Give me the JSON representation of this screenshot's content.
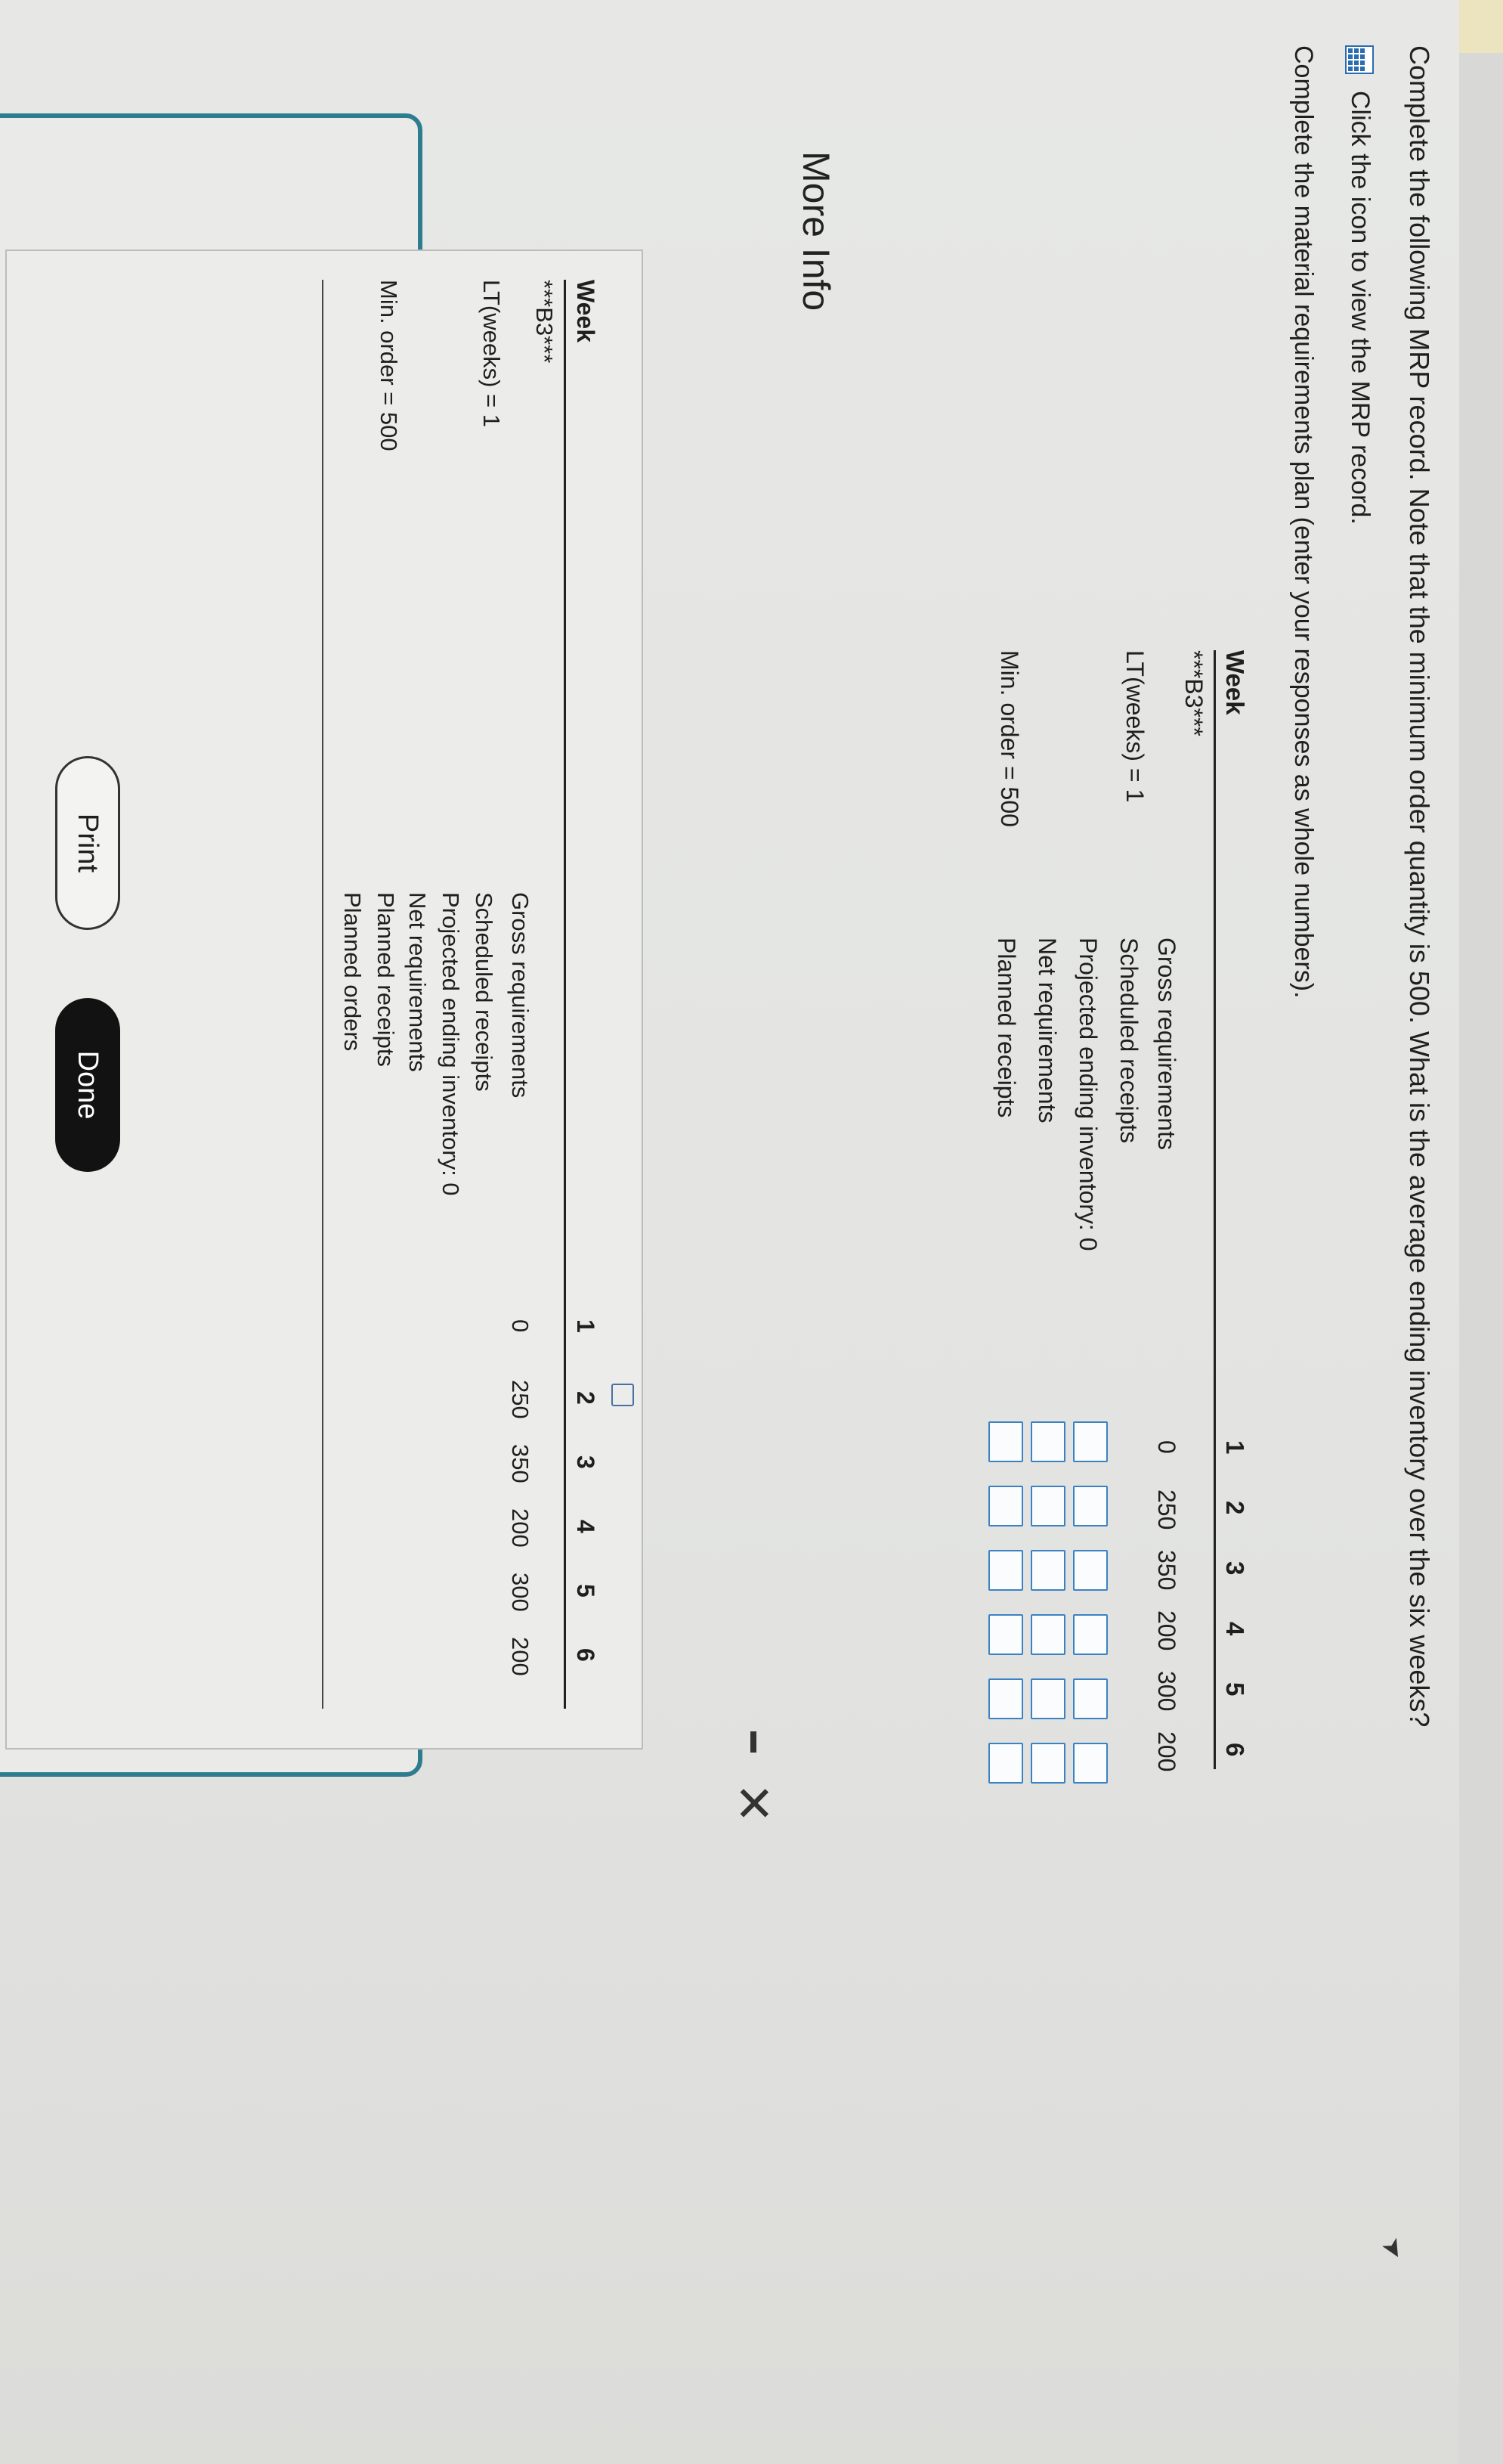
{
  "question": "Complete the following MRP record. Note that the minimum order quantity is 500. What is the average ending inventory over the six weeks?",
  "hint": {
    "icon": "table-grid-icon",
    "text": "Click the icon to view the MRP record."
  },
  "instructions": "Complete the material requirements plan (enter your responses as whole numbers).",
  "mrp": {
    "header_label": "Week",
    "weeks": [
      "1",
      "2",
      "3",
      "4",
      "5",
      "6"
    ],
    "item_label": "***B3***",
    "lead_time_label": "LT(weeks) = 1",
    "min_order_label": "Min. order = 500",
    "rows": {
      "gross_requirements": {
        "label": "Gross requirements",
        "values": [
          "0",
          "250",
          "350",
          "200",
          "300",
          "200"
        ]
      },
      "scheduled_receipts": {
        "label": "Scheduled receipts"
      },
      "projected_ending_inventory": {
        "label": "Projected ending inventory: 0"
      },
      "net_requirements": {
        "label": "Net requirements"
      },
      "planned_receipts": {
        "label": "Planned receipts"
      },
      "planned_orders": {
        "label": "Planned orders"
      }
    }
  },
  "modal": {
    "title": "More Info",
    "minimize": "–",
    "close": "✕",
    "print_label": "Print",
    "done_label": "Done"
  }
}
